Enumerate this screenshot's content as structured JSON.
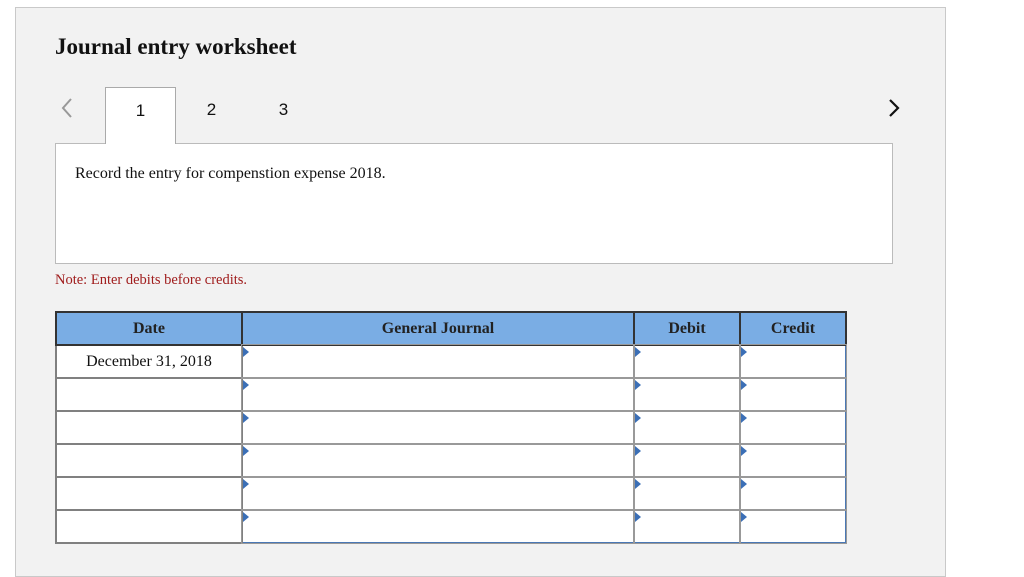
{
  "worksheet": {
    "title": "Journal entry worksheet",
    "nav": {
      "prev_icon": "chevron-left-icon",
      "next_icon": "chevron-right-icon"
    },
    "tabs": [
      {
        "label": "1",
        "active": true
      },
      {
        "label": "2",
        "active": false
      },
      {
        "label": "3",
        "active": false
      }
    ],
    "instruction": "Record the entry for compenstion expense 2018.",
    "note": "Note: Enter debits before credits."
  },
  "journal_table": {
    "headers": {
      "date": "Date",
      "general_journal": "General Journal",
      "debit": "Debit",
      "credit": "Credit"
    },
    "rows": [
      {
        "date": "December 31, 2018",
        "account": "",
        "debit": "",
        "credit": ""
      },
      {
        "date": "",
        "account": "",
        "debit": "",
        "credit": ""
      },
      {
        "date": "",
        "account": "",
        "debit": "",
        "credit": ""
      },
      {
        "date": "",
        "account": "",
        "debit": "",
        "credit": ""
      },
      {
        "date": "",
        "account": "",
        "debit": "",
        "credit": ""
      },
      {
        "date": "",
        "account": "",
        "debit": "",
        "credit": ""
      }
    ]
  },
  "colors": {
    "header_bg": "#7aade4",
    "input_border": "#4a78b5",
    "note_text": "#a01d1d",
    "panel_bg": "#f2f2f2"
  }
}
